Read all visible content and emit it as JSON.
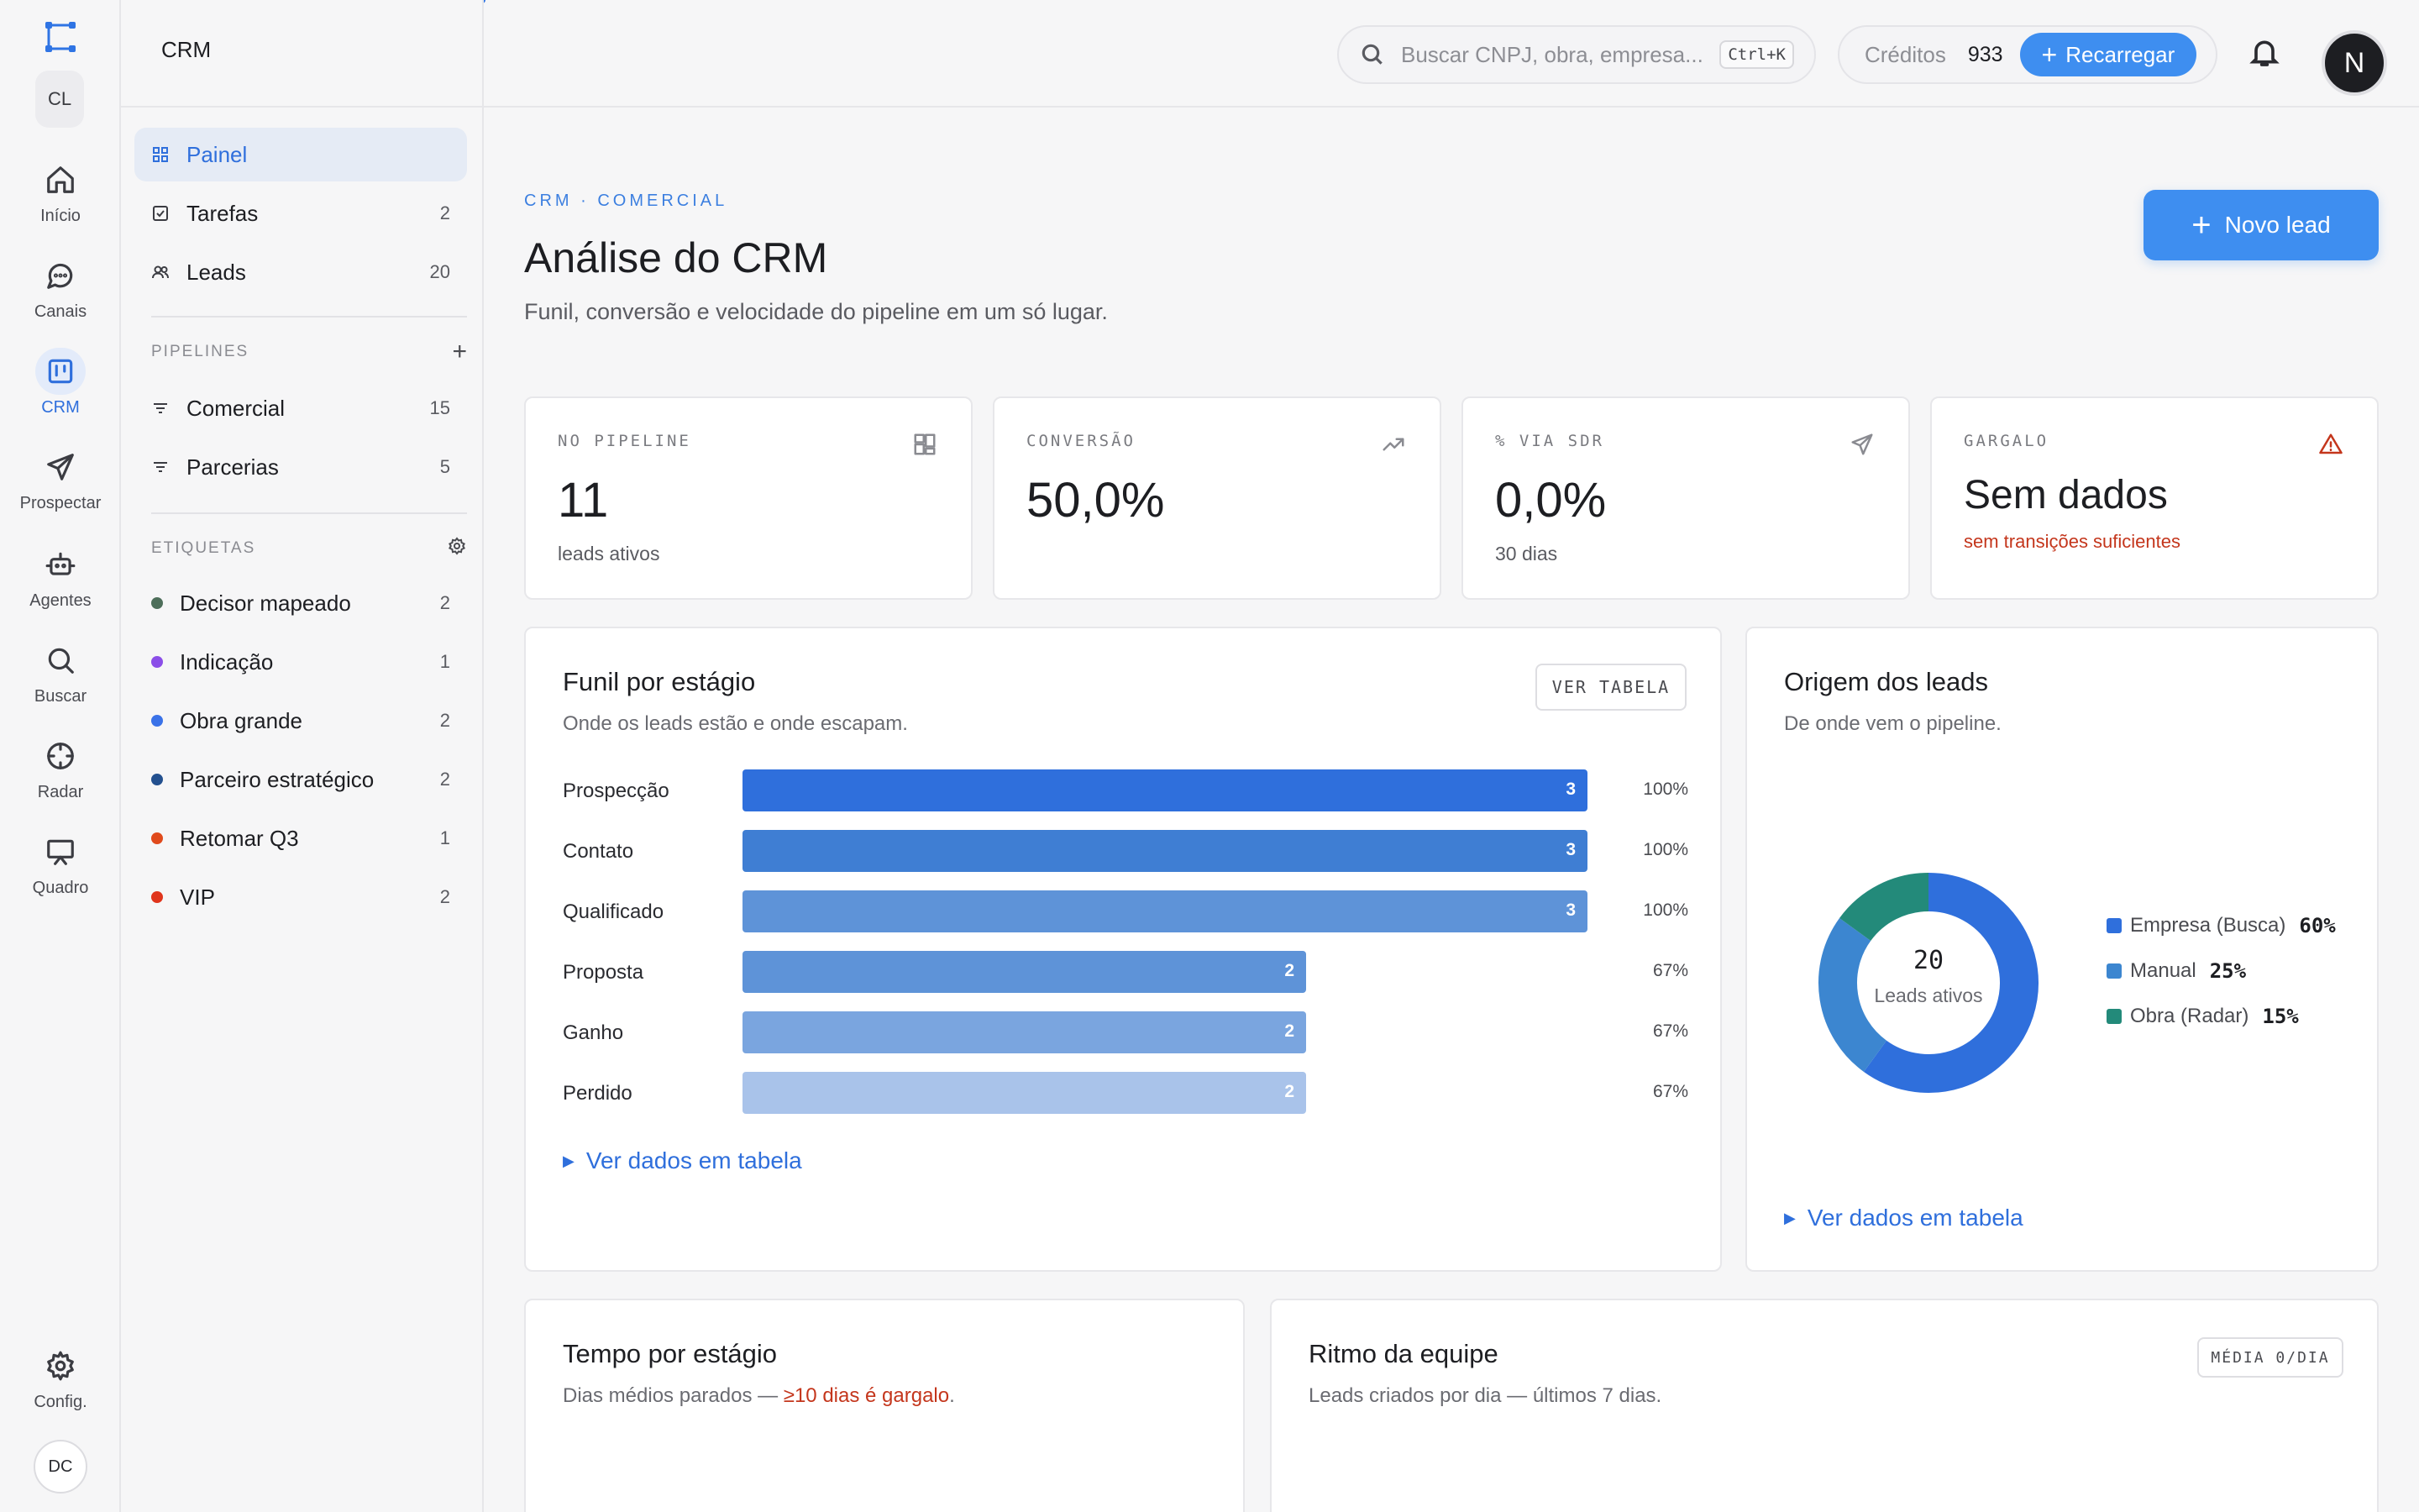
{
  "app": {
    "section_title": "CRM",
    "workspace_initials": "CL",
    "user_initials": "DC",
    "account_initial": "N"
  },
  "rail": [
    {
      "label": "Início",
      "icon": "home-icon",
      "active": false
    },
    {
      "label": "Canais",
      "icon": "chat-icon",
      "active": false
    },
    {
      "label": "CRM",
      "icon": "kanban-icon",
      "active": true
    },
    {
      "label": "Prospectar",
      "icon": "send-icon",
      "active": false
    },
    {
      "label": "Agentes",
      "icon": "robot-icon",
      "active": false
    },
    {
      "label": "Buscar",
      "icon": "search-icon",
      "active": false
    },
    {
      "label": "Radar",
      "icon": "crosshair-icon",
      "active": false
    },
    {
      "label": "Quadro",
      "icon": "presentation-icon",
      "active": false
    }
  ],
  "rail_settings_label": "Config.",
  "sidebar": {
    "nav": [
      {
        "label": "Painel",
        "count": "",
        "active": true
      },
      {
        "label": "Tarefas",
        "count": "2",
        "active": false
      },
      {
        "label": "Leads",
        "count": "20",
        "active": false
      }
    ],
    "pipelines_header": "PIPELINES",
    "pipelines": [
      {
        "label": "Comercial",
        "count": "15"
      },
      {
        "label": "Parcerias",
        "count": "5"
      }
    ],
    "tags_header": "ETIQUETAS",
    "tags": [
      {
        "label": "Decisor mapeado",
        "count": "2",
        "color": "#4d6e5a"
      },
      {
        "label": "Indicação",
        "count": "1",
        "color": "#8b4ee8"
      },
      {
        "label": "Obra grande",
        "count": "2",
        "color": "#3a72e8"
      },
      {
        "label": "Parceiro estratégico",
        "count": "2",
        "color": "#23508f"
      },
      {
        "label": "Retomar Q3",
        "count": "1",
        "color": "#e04a1c"
      },
      {
        "label": "VIP",
        "count": "2",
        "color": "#e0351c"
      }
    ]
  },
  "topbar": {
    "search_placeholder": "Buscar CNPJ, obra, empresa...",
    "search_shortcut": "Ctrl+K",
    "credits_label": "Créditos",
    "credits_value": "933",
    "recharge_label": "Recarregar"
  },
  "page": {
    "breadcrumb": "CRM · COMERCIAL",
    "title": "Análise do CRM",
    "subtitle": "Funil, conversão e velocidade do pipeline em um só lugar.",
    "new_lead_label": "Novo lead"
  },
  "kpis": [
    {
      "label": "NO PIPELINE",
      "value": "11",
      "sub": "leads ativos",
      "icon": "board-icon"
    },
    {
      "label": "CONVERSÃO",
      "value": "50,0%",
      "sub": "",
      "icon": "trend-up-icon"
    },
    {
      "label": "% VIA SDR",
      "value": "0,0%",
      "sub": "30 dias",
      "icon": "send-icon"
    },
    {
      "label": "GARGALO",
      "value": "Sem dados",
      "sub": "sem transições suficientes",
      "icon": "warning-icon"
    }
  ],
  "funnel": {
    "title": "Funil por estágio",
    "subtitle": "Onde os leads estão e onde escapam.",
    "table_button": "VER TABELA",
    "toggle": "Ver dados em tabela",
    "colors": [
      "#2f6fdc",
      "#3f7ed3",
      "#5e93d8",
      "#5e93d8",
      "#7aa5df",
      "#a9c3ea"
    ]
  },
  "origin": {
    "title": "Origem dos leads",
    "subtitle": "De onde vem o pipeline.",
    "center_value": "20",
    "center_label": "Leads ativos",
    "toggle": "Ver dados em tabela"
  },
  "time_card": {
    "title": "Tempo por estágio",
    "subtitle_prefix": "Dias médios parados — ",
    "subtitle_warn": "≥10 dias é gargalo",
    "subtitle_suffix": "."
  },
  "team_card": {
    "title": "Ritmo da equipe",
    "subtitle": "Leads criados por dia — últimos 7 dias.",
    "badge": "MÉDIA 0/DIA"
  },
  "chart_data": [
    {
      "type": "bar",
      "title": "Funil por estágio",
      "categories": [
        "Prospecção",
        "Contato",
        "Qualificado",
        "Proposta",
        "Ganho",
        "Perdido"
      ],
      "values": [
        3,
        3,
        3,
        2,
        2,
        2
      ],
      "percent_labels": [
        "100%",
        "100%",
        "100%",
        "67%",
        "67%",
        "67%"
      ],
      "xlim": [
        0,
        3
      ],
      "orientation": "horizontal"
    },
    {
      "type": "pie",
      "title": "Origem dos leads",
      "donut": true,
      "slices": [
        {
          "label": "Empresa (Busca)",
          "value": 60,
          "display": "60%",
          "color": "#2f6fdc"
        },
        {
          "label": "Manual",
          "value": 25,
          "display": "25%",
          "color": "#3c86d0"
        },
        {
          "label": "Obra (Radar)",
          "value": 15,
          "display": "15%",
          "color": "#238a7a"
        }
      ]
    }
  ]
}
